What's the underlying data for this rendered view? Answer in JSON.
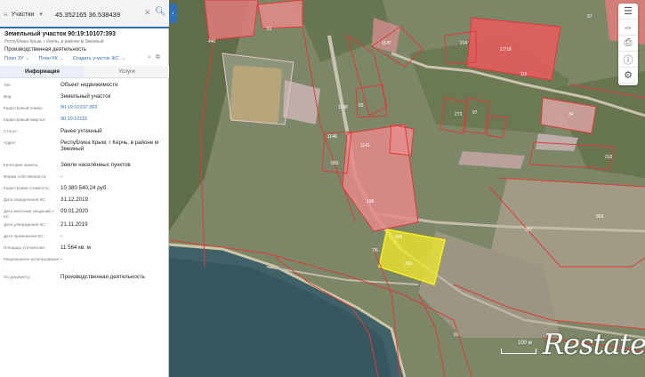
{
  "search": {
    "type_label": "Участки",
    "value": "45.352165 36.538439"
  },
  "object": {
    "title": "Земельный участок 90:19:10107:393",
    "subtitle": "Республика Крым, г Керчь, в районе м Змеиный",
    "use": "Производственная деятельность",
    "links": [
      "План ЗУ →",
      "План КК →",
      "Создать участок ЖС →"
    ]
  },
  "tabs": [
    "Информация",
    "Услуги"
  ],
  "rows": [
    {
      "k": "Тип:",
      "v": "Объект недвижимости"
    },
    {
      "k": "Вид:",
      "v": "Земельный участок"
    },
    {
      "k": "Кадастровый номер:",
      "v": "90:19:10107:393",
      "link": true
    },
    {
      "k": "Кадастровый квартал:",
      "v": "90:19:10115",
      "link": true
    },
    {
      "k": "Статус:",
      "v": "Ранее учтенный"
    },
    {
      "k": "Адрес:",
      "v": "Республика Крым, г Керчь, в районе м Змеиный"
    },
    {
      "k": "Категория земель:",
      "v": "Земли населённых пунктов"
    },
    {
      "k": "Форма собственности:",
      "v": "-"
    },
    {
      "k": "Кадастровая стоимость:",
      "v": "10 380 540,24 руб."
    },
    {
      "k": "Дата определения КС:",
      "v": "31.12.2019"
    },
    {
      "k": "Дата внесения сведений о КС:",
      "v": "09.01.2020"
    },
    {
      "k": "Дата утверждения КС:",
      "v": "21.11.2019"
    },
    {
      "k": "Дата применения КС:",
      "v": "-"
    },
    {
      "k": "Площадь уточненная:",
      "v": "11 564 кв. м"
    },
    {
      "k": "Разрешенное использование:",
      "v": "-"
    },
    {
      "k": "По документу:",
      "v": "Производственная деятельность"
    }
  ],
  "map": {
    "scale_label": "100 м",
    "watermark": "Restate",
    "labels": [
      "440",
      "91",
      "1147",
      "214",
      "17/18",
      "1/3",
      "65",
      "1138",
      "1148",
      "1141",
      "903",
      "198",
      "7/6",
      "393",
      "913",
      "273",
      "97",
      "957",
      "903"
    ]
  },
  "colors": {
    "accent": "#2f6fb3",
    "parcel_line": "#e03a3a",
    "selected": "#f3ea2a"
  }
}
